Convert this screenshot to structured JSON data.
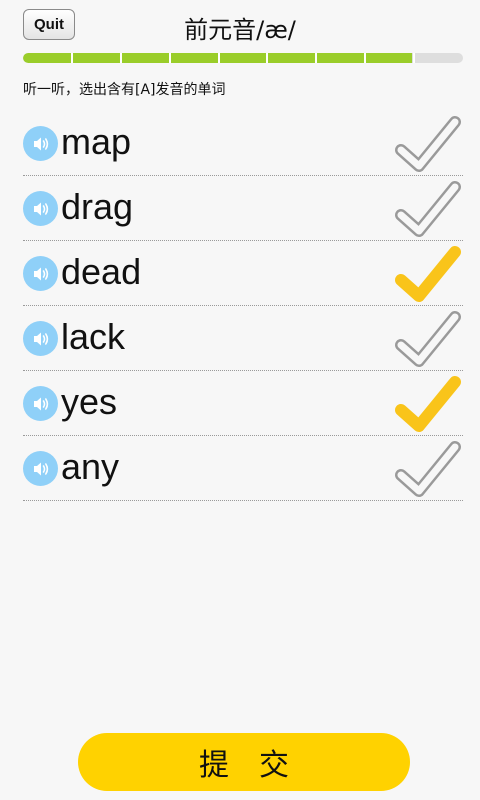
{
  "header": {
    "quit_label": "Quit",
    "title": "前元音/æ/"
  },
  "progress": {
    "fraction": 0.885,
    "segments": 9
  },
  "instruction": "听一听，选出含有[A]发音的单词",
  "words": [
    {
      "text": "map",
      "checked": false
    },
    {
      "text": "drag",
      "checked": false
    },
    {
      "text": "dead",
      "checked": true
    },
    {
      "text": "lack",
      "checked": false
    },
    {
      "text": "yes",
      "checked": true
    },
    {
      "text": "any",
      "checked": false
    }
  ],
  "submit_label": "提交",
  "colors": {
    "accent_yellow": "#ffd200",
    "check_yellow": "#f9c41a",
    "progress_green": "#9acd2a",
    "speaker_blue": "#8fd0f8"
  },
  "icons": {
    "speaker": "speaker-icon",
    "check": "check-icon"
  }
}
